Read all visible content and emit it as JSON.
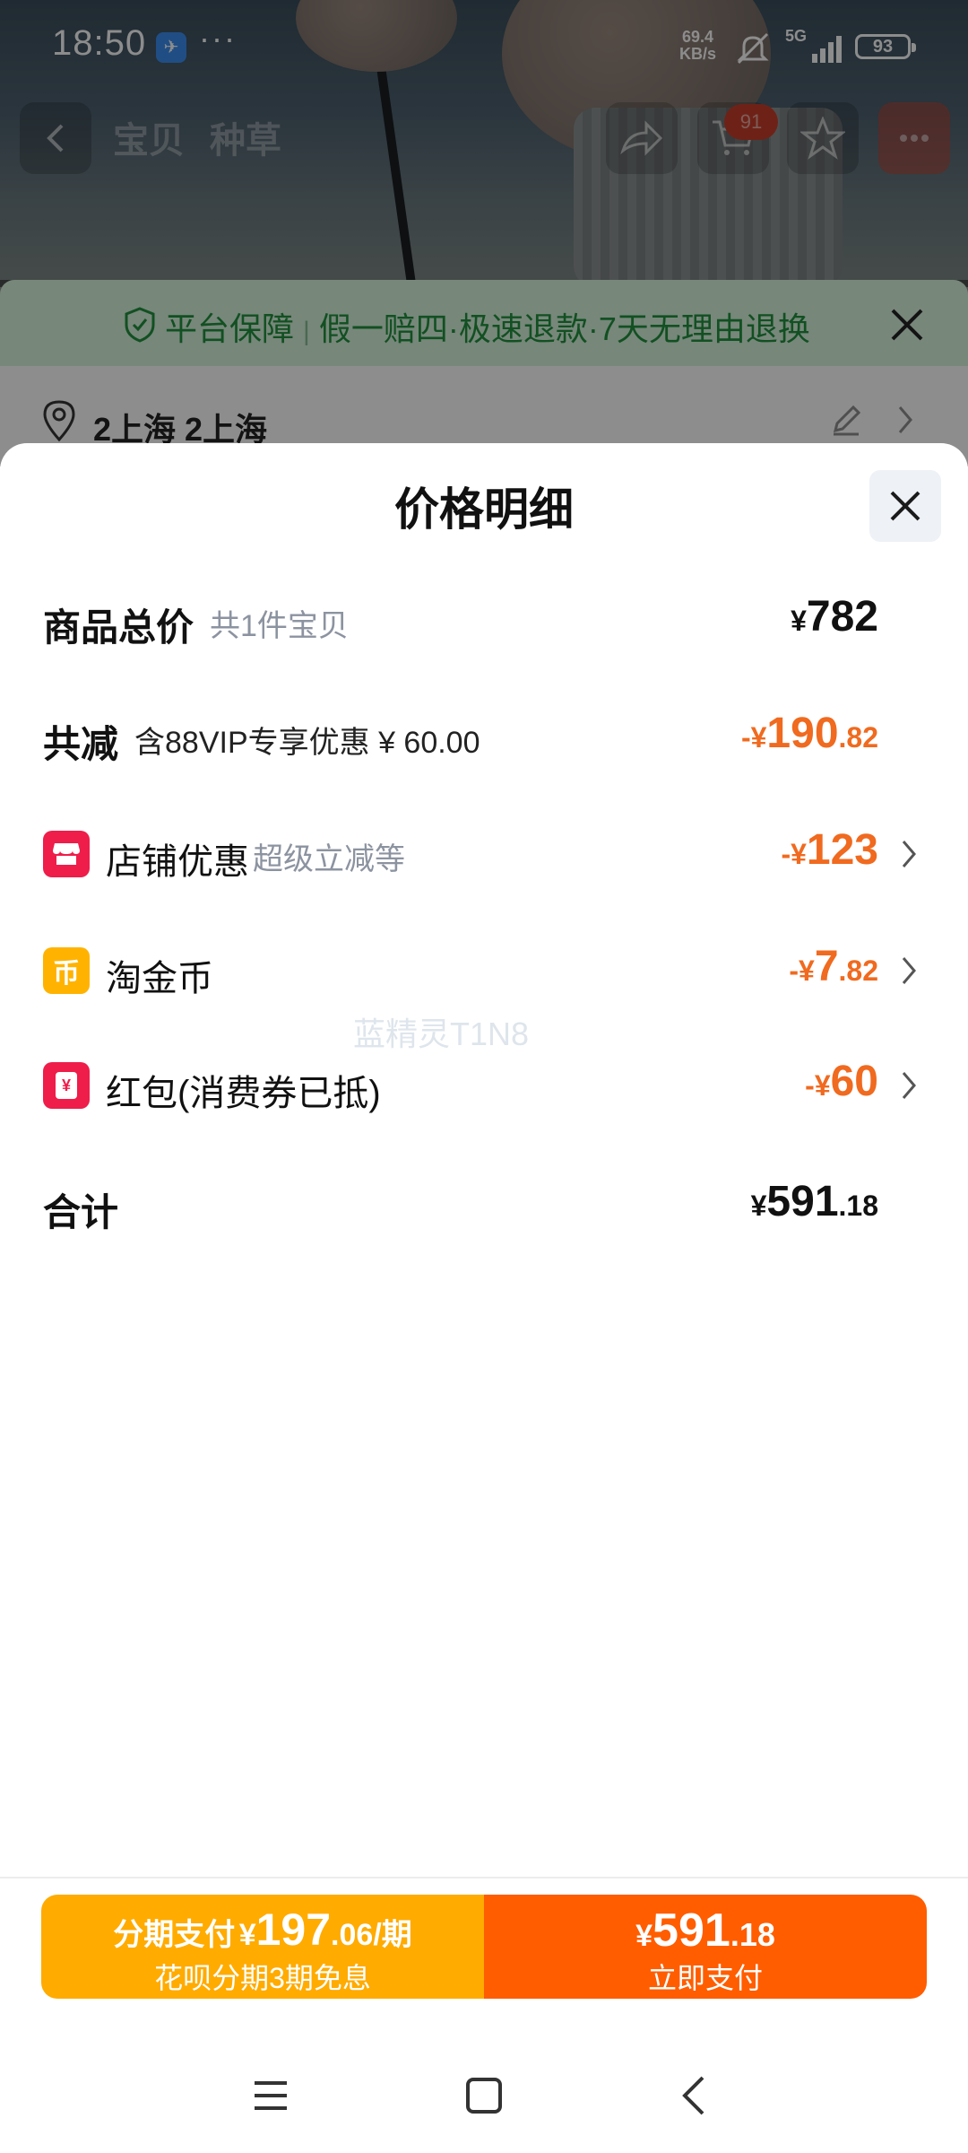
{
  "status_bar": {
    "time": "18:50",
    "more": "···",
    "net_speed_value": "69.4",
    "net_speed_unit": "KB/s",
    "network": "5G",
    "battery": "93",
    "icons": [
      "app-notification-icon",
      "mute-icon",
      "signal-icon",
      "battery-icon"
    ]
  },
  "background_page": {
    "tabs": [
      "宝贝",
      "种草"
    ],
    "cart_badge": "91",
    "guarantee": {
      "title": "平台保障",
      "separator": "|",
      "items": "假一赔四·极速退款·7天无理由退换"
    },
    "address": "2上海 2上海"
  },
  "sheet": {
    "title": "价格明细",
    "rows": {
      "total": {
        "label": "商品总价",
        "sub": "共1件宝贝",
        "yen": "¥",
        "int": "782",
        "dec": ""
      },
      "discount": {
        "label": "共减",
        "note": "含88VIP专享优惠 ¥ 60.00",
        "prefix": "-¥",
        "int": "190",
        "dec": ".82"
      },
      "shop": {
        "label": "店铺优惠",
        "sub": "超级立减等",
        "prefix": "-¥",
        "int": "123",
        "dec": ""
      },
      "coin": {
        "label": "淘金币",
        "prefix": "-¥",
        "int": "7",
        "dec": ".82"
      },
      "redpacket": {
        "label": "红包(消费券已抵)",
        "prefix": "-¥",
        "int": "60",
        "dec": ""
      },
      "sum": {
        "label": "合计",
        "yen": "¥",
        "int": "591",
        "dec": ".18"
      }
    },
    "watermark": "蓝精灵T1N8"
  },
  "action_bar": {
    "installment": {
      "label": "分期支付",
      "yen": "¥",
      "int": "197",
      "dec": ".06",
      "suffix": "/期",
      "sub": "花呗分期3期免息"
    },
    "pay": {
      "yen": "¥",
      "int": "591",
      "dec": ".18",
      "sub": "立即支付"
    }
  },
  "colors": {
    "accent_orange": "#f06a1f",
    "installment_bg": "#ffab00",
    "pay_bg": "#ff5d00",
    "guarantee_green": "#1f8a3b"
  }
}
